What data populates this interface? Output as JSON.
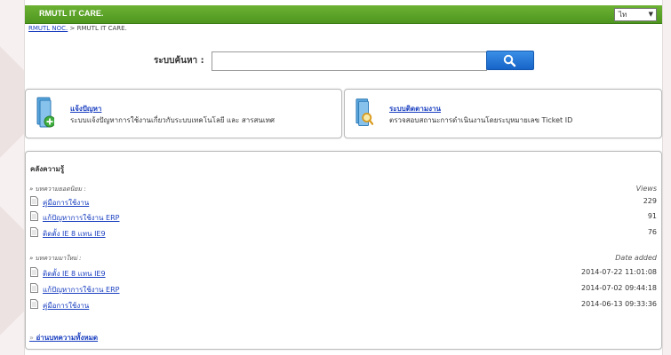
{
  "app": {
    "title": "RMUTL IT CARE.",
    "language": "ไท"
  },
  "breadcrumb": {
    "home": "RMUTL NOC.",
    "separator": ">",
    "current": "RMUTL IT CARE."
  },
  "search": {
    "label": "ระบบค้นหา :",
    "value": "",
    "button_icon": "search-icon"
  },
  "cards": [
    {
      "title": "แจ้งปัญหา",
      "desc": "ระบบแจ้งปัญหาการใช้งานเกี่ยวกับระบบเทคโนโลยี และ สารสนเทศ",
      "icon": "document-add-icon"
    },
    {
      "title": "ระบบติดตามงาน",
      "desc": "ตรวจสอบสถานะการดำเนินงานโดยระบุหมายเลข Ticket ID",
      "icon": "document-search-icon"
    }
  ],
  "knowledge": {
    "title": "คลังความรู้",
    "popular": {
      "label": "บทความยอดนิยม :",
      "column": "Views",
      "items": [
        {
          "title": "คู่มือการใช้งาน",
          "value": "229"
        },
        {
          "title": "แก้ปัญหาการใช้งาน ERP",
          "value": "91"
        },
        {
          "title": "ติดตั้ง IE 8 แทน IE9",
          "value": "76"
        }
      ]
    },
    "latest": {
      "label": "บทความมาใหม่ :",
      "column": "Date added",
      "items": [
        {
          "title": "ติดตั้ง IE 8 แทน IE9",
          "value": "2014-07-22 11:01:08"
        },
        {
          "title": "แก้ปัญหาการใช้งาน ERP",
          "value": "2014-07-02 09:44:18"
        },
        {
          "title": "คู่มือการใช้งาน",
          "value": "2014-06-13 09:33:36"
        }
      ]
    },
    "read_all": "อ่านบทความทั้งหมด"
  },
  "colors": {
    "brand_green": "#4e9620",
    "link": "#1a3fc0",
    "search_button": "#1764c8"
  }
}
